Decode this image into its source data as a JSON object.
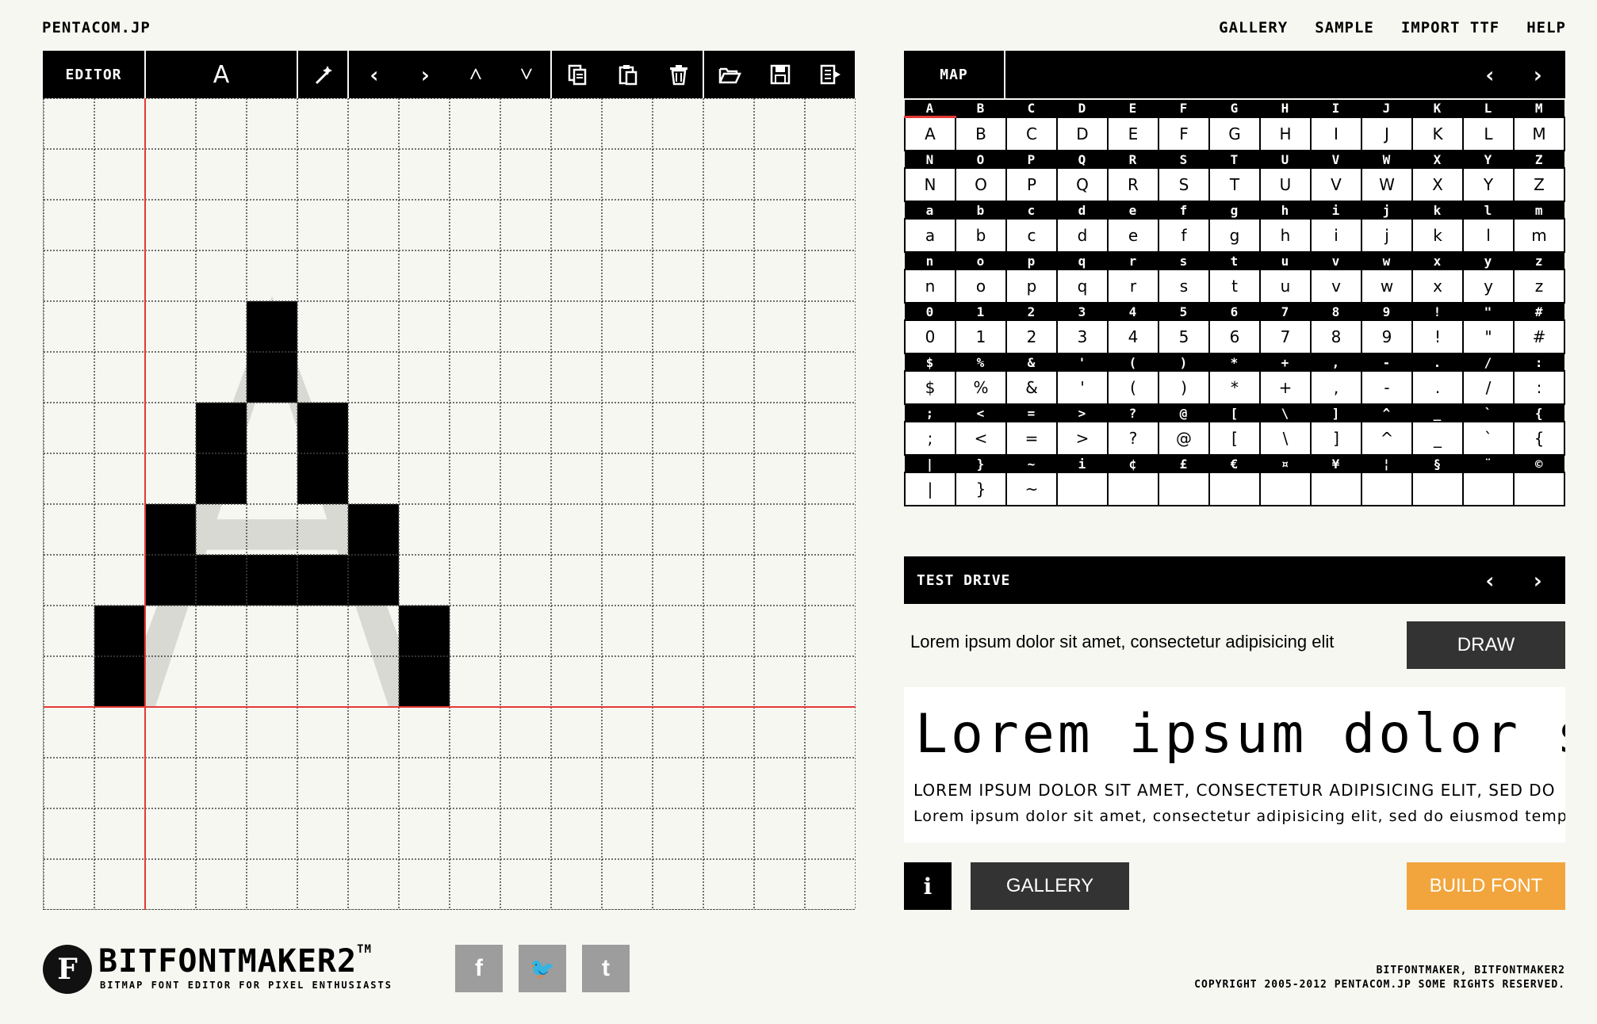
{
  "header": {
    "site_name": "PENTACOM.JP",
    "nav": [
      "GALLERY",
      "SAMPLE",
      "IMPORT TTF",
      "HELP"
    ]
  },
  "editor": {
    "label": "EDITOR",
    "current_glyph": "A",
    "tools": [
      {
        "icon": "magic-wand-icon"
      },
      {
        "icon": "arrow-left-icon",
        "glyph": "‹"
      },
      {
        "icon": "arrow-right-icon",
        "glyph": "›"
      },
      {
        "icon": "arrow-up-icon",
        "glyph": "˄"
      },
      {
        "icon": "arrow-down-icon",
        "glyph": "˅"
      },
      {
        "icon": "copy-icon"
      },
      {
        "icon": "paste-icon"
      },
      {
        "icon": "trash-icon"
      },
      {
        "icon": "open-folder-icon"
      },
      {
        "icon": "save-icon"
      },
      {
        "icon": "export-icon"
      }
    ],
    "grid_size": 16,
    "pixels": [
      [
        2,
        4
      ],
      [
        2,
        5
      ],
      [
        1,
        6
      ],
      [
        3,
        6
      ],
      [
        1,
        7
      ],
      [
        3,
        7
      ],
      [
        0,
        8
      ],
      [
        4,
        8
      ],
      [
        0,
        9
      ],
      [
        1,
        9
      ],
      [
        2,
        9
      ],
      [
        3,
        9
      ],
      [
        4,
        9
      ],
      [
        -1,
        10
      ],
      [
        5,
        10
      ],
      [
        -1,
        11
      ],
      [
        5,
        11
      ]
    ],
    "baseline_row": 12,
    "origin_col": 2
  },
  "map": {
    "label": "MAP",
    "prev": "‹",
    "next": "›",
    "selected": "A",
    "rows": [
      [
        "A",
        "B",
        "C",
        "D",
        "E",
        "F",
        "G",
        "H",
        "I",
        "J",
        "K",
        "L",
        "M"
      ],
      [
        "N",
        "O",
        "P",
        "Q",
        "R",
        "S",
        "T",
        "U",
        "V",
        "W",
        "X",
        "Y",
        "Z"
      ],
      [
        "a",
        "b",
        "c",
        "d",
        "e",
        "f",
        "g",
        "h",
        "i",
        "j",
        "k",
        "l",
        "m"
      ],
      [
        "n",
        "o",
        "p",
        "q",
        "r",
        "s",
        "t",
        "u",
        "v",
        "w",
        "x",
        "y",
        "z"
      ],
      [
        "0",
        "1",
        "2",
        "3",
        "4",
        "5",
        "6",
        "7",
        "8",
        "9",
        "!",
        "\"",
        "#"
      ],
      [
        "$",
        "%",
        "&",
        "'",
        "(",
        ")",
        "*",
        "+",
        ",",
        "-",
        ".",
        "/",
        ":"
      ],
      [
        ";",
        "<",
        "=",
        ">",
        "?",
        "@",
        "[",
        "\\",
        "]",
        "^",
        "_",
        "`",
        "{"
      ],
      [
        "|",
        "}",
        "~",
        "i",
        "¢",
        "£",
        "€",
        "¤",
        "¥",
        "¦",
        "§",
        "¨",
        "©"
      ]
    ],
    "rows_drawn": [
      [
        "A",
        "B",
        "C",
        "D",
        "E",
        "F",
        "G",
        "H",
        "I",
        "J",
        "K",
        "L",
        "M"
      ],
      [
        "N",
        "O",
        "P",
        "Q",
        "R",
        "S",
        "T",
        "U",
        "V",
        "W",
        "X",
        "Y",
        "Z"
      ],
      [
        "a",
        "b",
        "c",
        "d",
        "e",
        "f",
        "g",
        "h",
        "i",
        "j",
        "k",
        "l",
        "m"
      ],
      [
        "n",
        "o",
        "p",
        "q",
        "r",
        "s",
        "t",
        "u",
        "v",
        "w",
        "x",
        "y",
        "z"
      ],
      [
        "0",
        "1",
        "2",
        "3",
        "4",
        "5",
        "6",
        "7",
        "8",
        "9",
        "!",
        "\"",
        "#"
      ],
      [
        "$",
        "%",
        "&",
        "'",
        "(",
        ")",
        "*",
        "+",
        ",",
        "-",
        ".",
        "/",
        ":"
      ],
      [
        ";",
        "<",
        "=",
        ">",
        "?",
        "@",
        "[",
        "\\",
        "]",
        "^",
        "_",
        "`",
        "{"
      ],
      [
        "|",
        "}",
        "~",
        "",
        "",
        "",
        "",
        "",
        "",
        "",
        "",
        "",
        ""
      ]
    ]
  },
  "test_drive": {
    "label": "TEST DRIVE",
    "prev": "‹",
    "next": "›",
    "input_text": "Lorem ipsum dolor sit amet, consectetur adipisicing elit",
    "draw_label": "DRAW",
    "preview_large": "Lorem ipsum dolor sit amet",
    "preview_caps": "LOREM IPSUM DOLOR SIT AMET, CONSECTETUR ADIPISICING ELIT, SED DO",
    "preview_small": "Lorem ipsum dolor sit amet, consectetur adipisicing elit, sed do eiusmod tempor"
  },
  "actions": {
    "info_label": "i",
    "gallery_label": "GALLERY",
    "build_label": "BUILD FONT",
    "build_color": "#f2a53c"
  },
  "footer": {
    "logo_letter": "F",
    "logo_text": "BITFONTMAKER2",
    "logo_tm": "TM",
    "tagline": "BITMAP FONT EDITOR FOR PIXEL ENTHUSIASTS",
    "social": [
      {
        "icon": "facebook-icon",
        "glyph": "f"
      },
      {
        "icon": "twitter-icon",
        "glyph": "🐦"
      },
      {
        "icon": "tumblr-icon",
        "glyph": "t"
      }
    ],
    "right_line1": "BITFONTMAKER, BITFONTMAKER2",
    "right_line2": "COPYRIGHT 2005-2012 PENTACOM.JP SOME RIGHTS RESERVED."
  }
}
